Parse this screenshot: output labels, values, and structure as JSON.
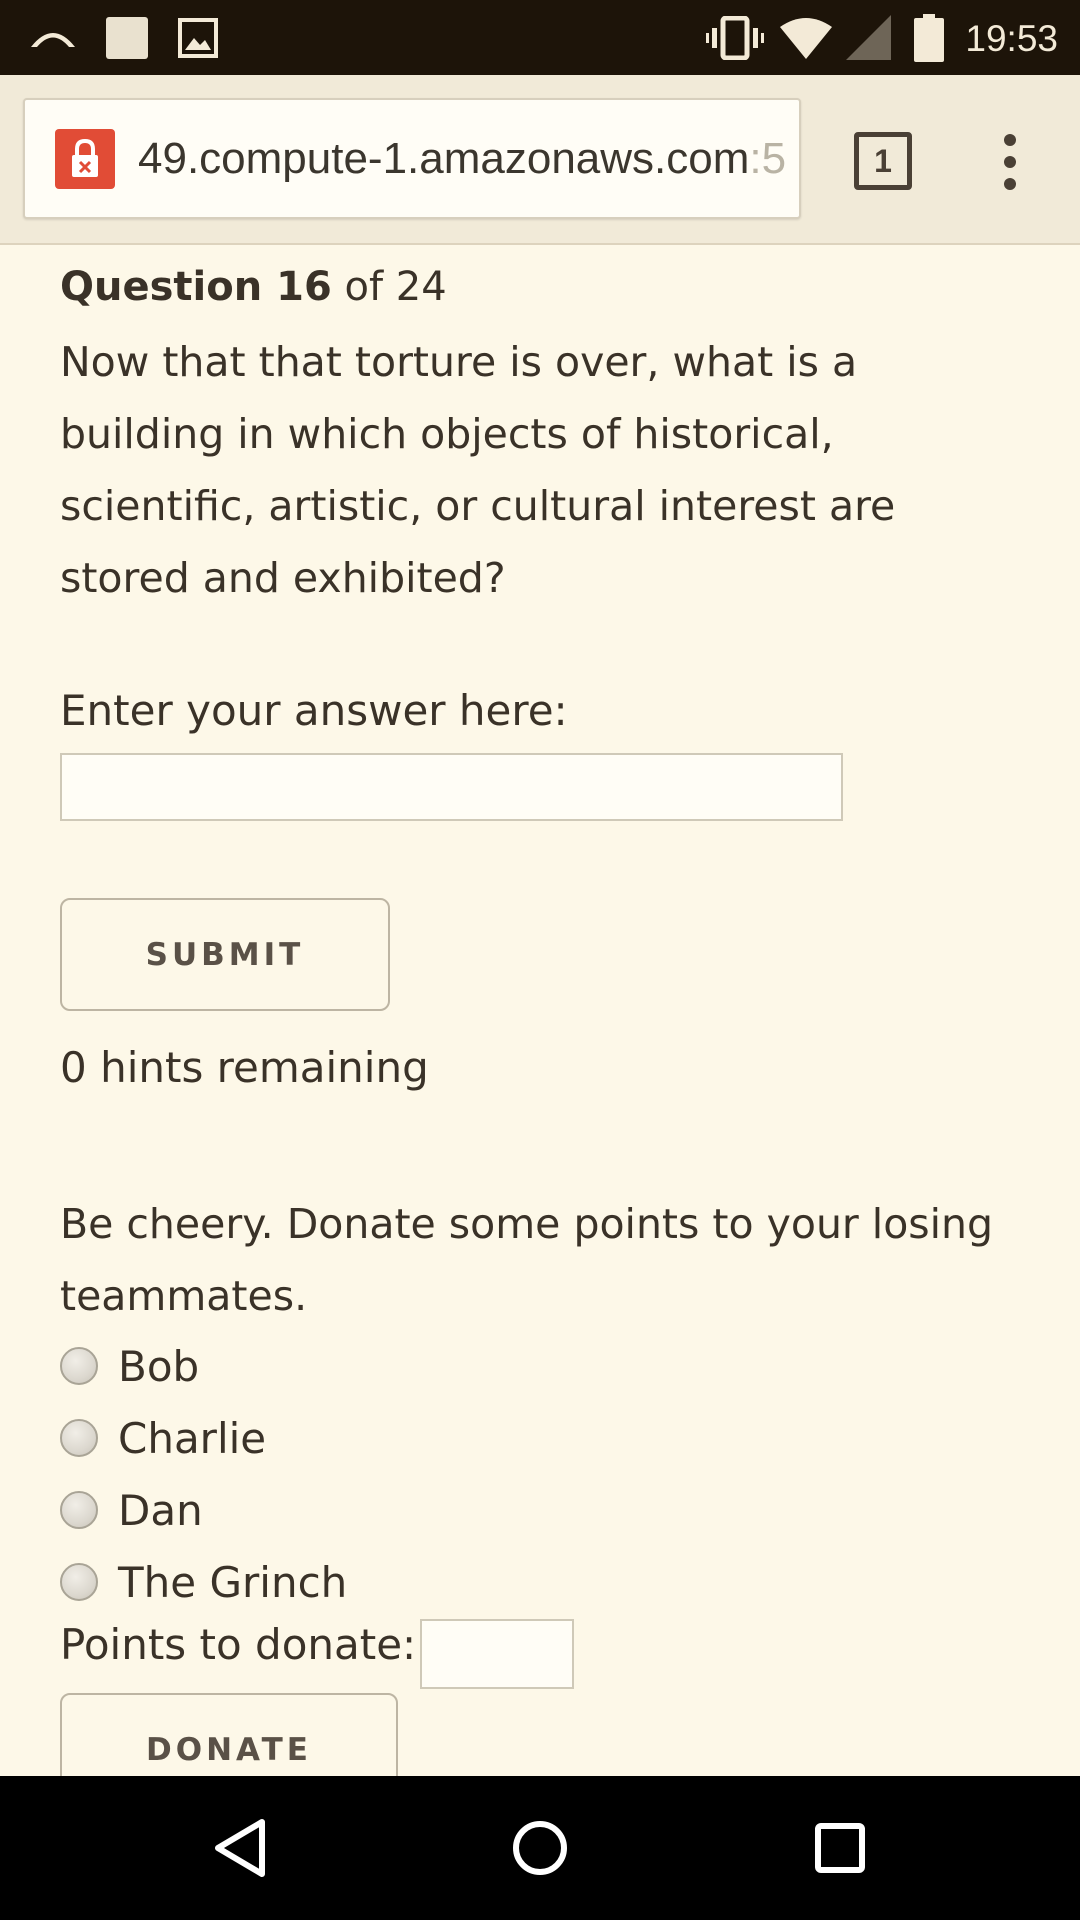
{
  "status_bar": {
    "time": "19:53",
    "icons": [
      "cast-icon",
      "notification-square-icon",
      "image-icon",
      "vibrate-icon",
      "wifi-icon",
      "cell-signal-icon",
      "battery-icon"
    ]
  },
  "browser": {
    "url_main": "49.compute-1.amazonaws.com",
    "url_faded": ":5",
    "tab_count": "1",
    "lock_icon": "lock-error-icon",
    "menu_icon": "more-vert-icon"
  },
  "question": {
    "label": "Question 16",
    "of_text": " of 24",
    "text": "Now that that torture is over, what is a building in which objects of historical, scientific, artistic, or cultural interest are stored and exhibited?"
  },
  "answer": {
    "label": "Enter your answer here:",
    "value": "",
    "submit_label": "SUBMIT"
  },
  "hints": {
    "text": "0 hints remaining"
  },
  "donate": {
    "prompt": "Be cheery. Donate some points to your losing teammates.",
    "options": [
      "Bob",
      "Charlie",
      "Dan",
      "The Grinch"
    ],
    "points_label": "Points to donate:",
    "points_value": "",
    "button_label": "DONATE"
  },
  "nav_bar": {
    "icons": [
      "back-icon",
      "home-icon",
      "recents-icon"
    ]
  },
  "colors": {
    "page_background": "#fdf8e8",
    "status_bar": "#1d1409",
    "lock_badge": "#e14c36",
    "text": "#3a3228"
  }
}
